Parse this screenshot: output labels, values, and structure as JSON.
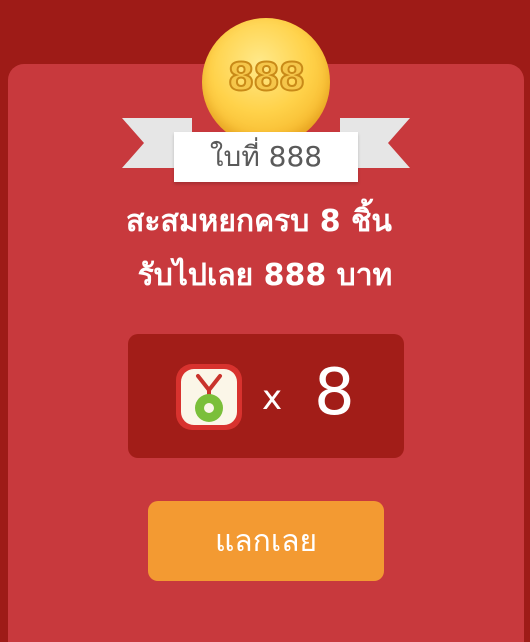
{
  "coin": {
    "label": "888"
  },
  "ribbon": {
    "label": "ใบที่ 888"
  },
  "title": {
    "line1": "สะสมหยกครบ 8 ชิ้น",
    "line2": "รับไปเลย 888 บาท"
  },
  "stamp": {
    "icon": "jade-pendant-icon",
    "times": "x",
    "count": "8"
  },
  "redeem": {
    "label": "แลกเลย"
  },
  "colors": {
    "background": "#9e1b17",
    "card": "#c8393d",
    "stamp_box": "#a21d18",
    "button": "#f39a32",
    "coin": "#ffd24a"
  }
}
